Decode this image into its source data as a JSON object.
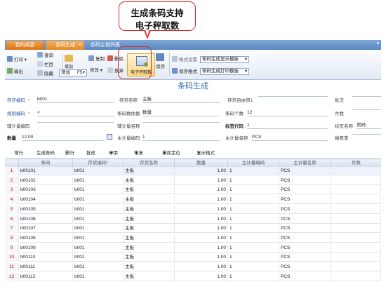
{
  "callout": {
    "line1": "生成条码支持",
    "line2": "电子秤取数"
  },
  "tabs": {
    "desktop": "我的桌面",
    "active": "条码生成",
    "close": "×",
    "other": "条码主档列表",
    "dropdown": "▾"
  },
  "toolbar": {
    "print": "打印",
    "preview": "查询",
    "layout": "栏目",
    "output": "输出",
    "hide": "隐藏",
    "add": "增加",
    "add_mode": "增加",
    "f5": "F5",
    "copy": "复制",
    "delete": "删除",
    "modify": "修改",
    "discard": "放弃",
    "scale_fetch": "电子秤取数",
    "save": "保存",
    "format_setting": "格式设置",
    "save_format": "保存格式",
    "display_template": "条码生成显示模板",
    "print_template": "条码生成打印模板"
  },
  "form": {
    "title": "条码生成",
    "inventory_code_label": "存货编码",
    "inventory_code_value": "b001",
    "inventory_name_label": "存货名称",
    "inventory_name_value": "主板",
    "free_item1_label": "存货自由项1",
    "batch_label": "批次",
    "rule_code_label": "规则编码",
    "rule_code_value": "<",
    "barcode_basis_label": "条码数依据",
    "barcode_basis_value": "数量",
    "barcode_count_label": "条码个数",
    "barcode_count_value": "12",
    "pieces_label": "件数",
    "aux_unit_code_label": "辅计量编码",
    "aux_unit_name_label": "辅计量名称",
    "label_code_label": "标签代码",
    "label_code_value": "1",
    "label_name_label": "标签名称",
    "label_name_value": "货码",
    "qty_label": "数量",
    "qty_value": "12.00",
    "main_unit_code_label": "主计量编码",
    "main_unit_code_value": "1",
    "main_unit_name_label": "主计量名称",
    "main_unit_name_value": "PCS",
    "conv_rate_label": "换算率"
  },
  "grid_toolbar": {
    "add_row": "增行",
    "gen_barcode": "生成条码",
    "del_row": "删行",
    "batch_mod": "批改",
    "disable": "停用",
    "restore": "恢复",
    "sort_locate": "排序定位",
    "show_format": "显示格式"
  },
  "grid": {
    "headers": [
      "条码",
      "存货编码*",
      "存货名称",
      "数量",
      "主计量编码",
      "主计量名称",
      "件数"
    ],
    "rows": [
      {
        "n": "1",
        "barcode": "b00101",
        "inv": "b001",
        "name": "主板",
        "qty": "1.00",
        "unit": "1",
        "uname": "PCS"
      },
      {
        "n": "2",
        "barcode": "b00102",
        "inv": "b001",
        "name": "主板",
        "qty": "1.00",
        "unit": "1",
        "uname": "PCS"
      },
      {
        "n": "3",
        "barcode": "b00103",
        "inv": "b001",
        "name": "主板",
        "qty": "1.00",
        "unit": "1",
        "uname": "PCS"
      },
      {
        "n": "4",
        "barcode": "b00104",
        "inv": "b001",
        "name": "主板",
        "qty": "1.00",
        "unit": "1",
        "uname": "PCS"
      },
      {
        "n": "5",
        "barcode": "b00105",
        "inv": "b001",
        "name": "主板",
        "qty": "1.00",
        "unit": "1",
        "uname": "PCS"
      },
      {
        "n": "6",
        "barcode": "b00106",
        "inv": "b001",
        "name": "主板",
        "qty": "1.00",
        "unit": "1",
        "uname": "PCS"
      },
      {
        "n": "7",
        "barcode": "b00107",
        "inv": "b001",
        "name": "主板",
        "qty": "1.00",
        "unit": "1",
        "uname": "PCS"
      },
      {
        "n": "8",
        "barcode": "b00108",
        "inv": "b001",
        "name": "主板",
        "qty": "1.00",
        "unit": "1",
        "uname": "PCS"
      },
      {
        "n": "9",
        "barcode": "b00109",
        "inv": "b001",
        "name": "主板",
        "qty": "1.00",
        "unit": "1",
        "uname": "PCS"
      },
      {
        "n": "10",
        "barcode": "b00110",
        "inv": "b001",
        "name": "主板",
        "qty": "1.00",
        "unit": "1",
        "uname": "PCS"
      },
      {
        "n": "11",
        "barcode": "b00111",
        "inv": "b001",
        "name": "主板",
        "qty": "1.00",
        "unit": "1",
        "uname": "PCS"
      },
      {
        "n": "12",
        "barcode": "b00112",
        "inv": "b001",
        "name": "主板",
        "qty": "1.00",
        "unit": "1",
        "uname": "PCS"
      }
    ]
  },
  "colors": {
    "accent": "#3a6db3",
    "tab_active": "#e3882a",
    "highlight": "#d9282b"
  }
}
